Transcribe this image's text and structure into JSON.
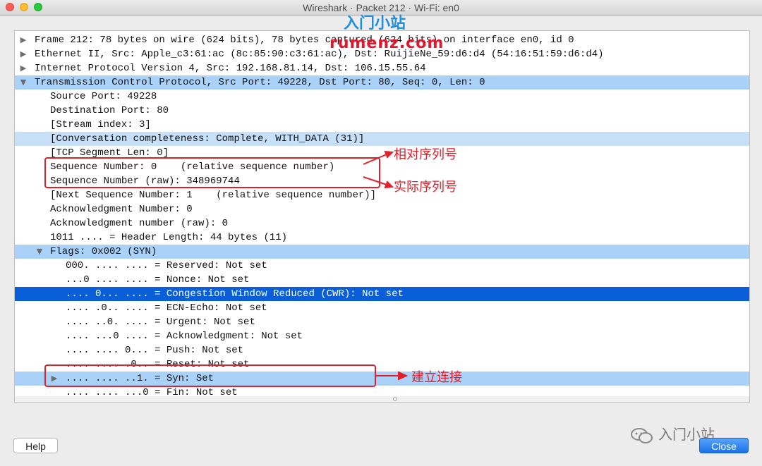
{
  "window": {
    "title": "Wireshark · Packet 212 · Wi-Fi: en0"
  },
  "watermark": {
    "brand": "入门小站",
    "url": "rumenz.com"
  },
  "tree_rows": [
    "Frame 212: 78 bytes on wire (624 bits), 78 bytes captured (624 bits) on interface en0, id 0",
    "Ethernet II, Src: Apple_c3:61:ac (8c:85:90:c3:61:ac), Dst: RuijieNe_59:d6:d4 (54:16:51:59:d6:d4)",
    "Internet Protocol Version 4, Src: 192.168.81.14, Dst: 106.15.55.64",
    "Transmission Control Protocol, Src Port: 49228, Dst Port: 80, Seq: 0, Len: 0",
    "Source Port: 49228",
    "Destination Port: 80",
    "[Stream index: 3]",
    "[Conversation completeness: Complete, WITH_DATA (31)]",
    "[TCP Segment Len: 0]",
    "Sequence Number: 0    (relative sequence number)",
    "Sequence Number (raw): 348969744",
    "[Next Sequence Number: 1    (relative sequence number)]",
    "Acknowledgment Number: 0",
    "Acknowledgment number (raw): 0",
    "1011 .... = Header Length: 44 bytes (11)",
    "Flags: 0x002 (SYN)",
    "000. .... .... = Reserved: Not set",
    "...0 .... .... = Nonce: Not set",
    ".... 0... .... = Congestion Window Reduced (CWR): Not set",
    ".... .0.. .... = ECN-Echo: Not set",
    ".... ..0. .... = Urgent: Not set",
    ".... ...0 .... = Acknowledgment: Not set",
    ".... .... 0... = Push: Not set",
    ".... .... .0.. = Reset: Not set",
    ".... .... ..1. = Syn: Set",
    ".... .... ...0 = Fin: Not set"
  ],
  "annotations": {
    "relative_seq": "相对序列号",
    "actual_seq": "实际序列号",
    "establish": "建立连接"
  },
  "buttons": {
    "help": "Help",
    "close": "Close"
  },
  "footer_watermark": "入门小站",
  "colors": {
    "selected_dark": "#0a5ed7",
    "selected_light": "#aad1f8",
    "annotation_red": "#e0202a"
  }
}
